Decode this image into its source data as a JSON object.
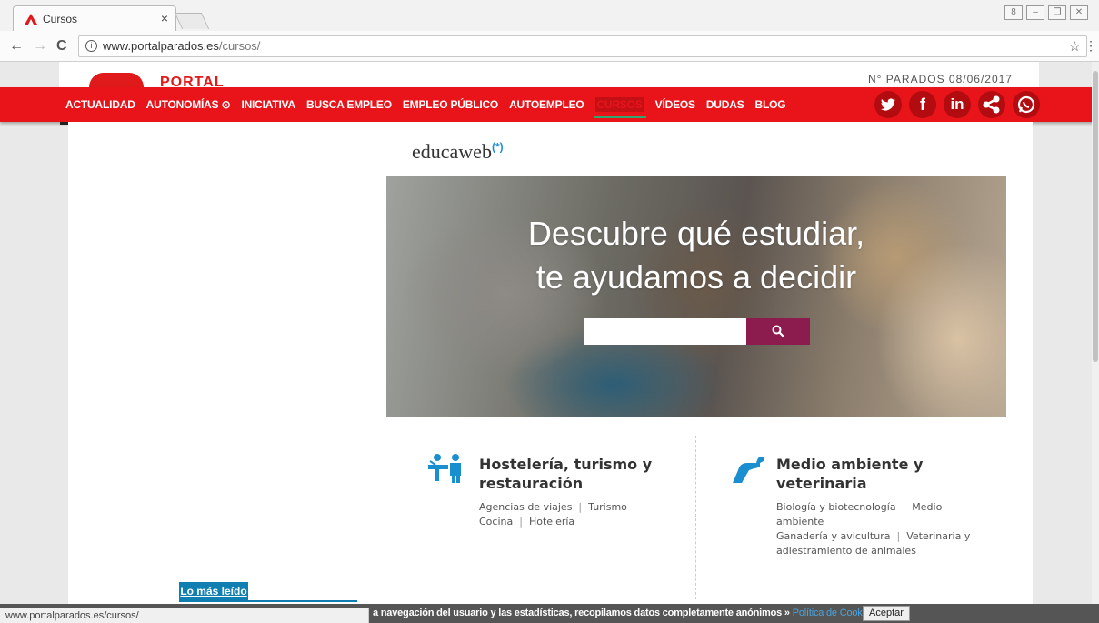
{
  "browser": {
    "tab_title": "Cursos",
    "tab_close": "×",
    "url_host": "www.portalparados.es",
    "url_path": "/cursos/",
    "info_icon": "i",
    "back": "←",
    "forward": "→",
    "reload": "C",
    "star": "☆",
    "menu": "⋮",
    "window_controls": [
      "8",
      "–",
      "❐",
      "✕"
    ]
  },
  "header": {
    "logo_text": "PORTAL",
    "parados_label": "N° PARADOS 08/06/2017"
  },
  "nav": {
    "items": [
      "ACTUALIDAD",
      "AUTONOMÍAS ⊙",
      "INICIATIVA",
      "BUSCA EMPLEO",
      "EMPLEO PÚBLICO",
      "AUTOEMPLEO",
      "CURSOS",
      "VÍDEOS",
      "DUDAS",
      "BLOG"
    ],
    "active_index": 6,
    "social": [
      "twitter-icon",
      "facebook-icon",
      "linkedin-icon",
      "share-icon",
      "whatsapp-icon"
    ],
    "social_glyphs": [
      "🐦",
      "f",
      "in",
      "<",
      "✆"
    ]
  },
  "brand": {
    "name": "educaweb",
    "mark": "(*)",
    "accent": "#1f8fd8"
  },
  "hero": {
    "line1": "Descubre qué estudiar,",
    "line2": "te ayudamos a decidir",
    "search_placeholder": "",
    "search_icon": "🔍"
  },
  "categories": [
    {
      "title_line1": "Hostelería, turismo y",
      "title_line2": "restauración",
      "links_row1": [
        "Agencias de viajes",
        "Turismo"
      ],
      "links_row2": [
        "Cocina",
        "Hotelería"
      ]
    },
    {
      "title_line1": "Medio ambiente y",
      "title_line2": "veterinaria",
      "links_row1": "Biología y biotecnología",
      "links_row1b": "Medio",
      "links_row2": "ambiente",
      "links_row3": "Ganadería y avicultura",
      "links_row3b": "Veterinaria y",
      "links_row4": "adiestramiento de animales"
    }
  ],
  "sidebar": {
    "mas_leido": "Lo más leído"
  },
  "cookie": {
    "text": "a navegación del usuario y las estadísticas, recopilamos datos completamente anónimos »",
    "link": "Política de Cookies",
    "button": "Aceptar"
  },
  "status": {
    "url": "www.portalparados.es/cursos/"
  },
  "colors": {
    "nav_red": "#e8141a",
    "hero_button": "#8c1c4e",
    "icon_blue": "#1a8fd0"
  }
}
